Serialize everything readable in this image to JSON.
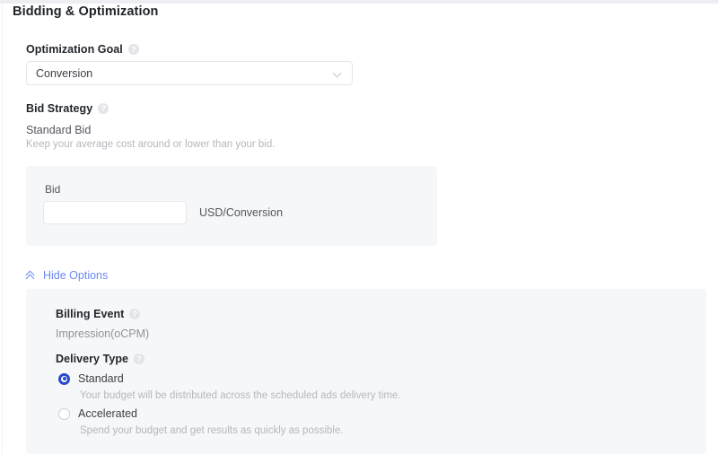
{
  "section": {
    "title": "Bidding & Optimization"
  },
  "optimization_goal": {
    "label": "Optimization Goal",
    "help_icon": "help-circle-icon",
    "help_glyph": "?",
    "selected": "Conversion",
    "chevron_icon": "chevron-down-icon"
  },
  "bid_strategy": {
    "label": "Bid Strategy",
    "help_icon": "help-circle-icon",
    "help_glyph": "?",
    "name": "Standard Bid",
    "description": "Keep your average cost around or lower than your bid."
  },
  "bid": {
    "label": "Bid",
    "value": "",
    "placeholder": "",
    "unit": "USD/Conversion"
  },
  "options_toggle": {
    "label": "Hide Options",
    "icon": "double-chevron-up-icon",
    "expanded": true
  },
  "options": {
    "billing_event": {
      "label": "Billing Event",
      "help_icon": "help-circle-icon",
      "help_glyph": "?",
      "value": "Impression(oCPM)"
    },
    "delivery_type": {
      "label": "Delivery Type",
      "help_icon": "help-circle-icon",
      "help_glyph": "?",
      "options": [
        {
          "label": "Standard",
          "description": "Your budget will be distributed across the scheduled ads delivery time.",
          "selected": true
        },
        {
          "label": "Accelerated",
          "description": "Spend your budget and get results as quickly as possible.",
          "selected": false
        }
      ]
    }
  },
  "colors": {
    "accent_link": "#6b8af5",
    "radio_selected": "#2b4acb",
    "panel_background": "#f6f7f9",
    "page_background": "#ffffff",
    "text_primary": "#1f2329",
    "text_muted": "#b4b7bd"
  }
}
